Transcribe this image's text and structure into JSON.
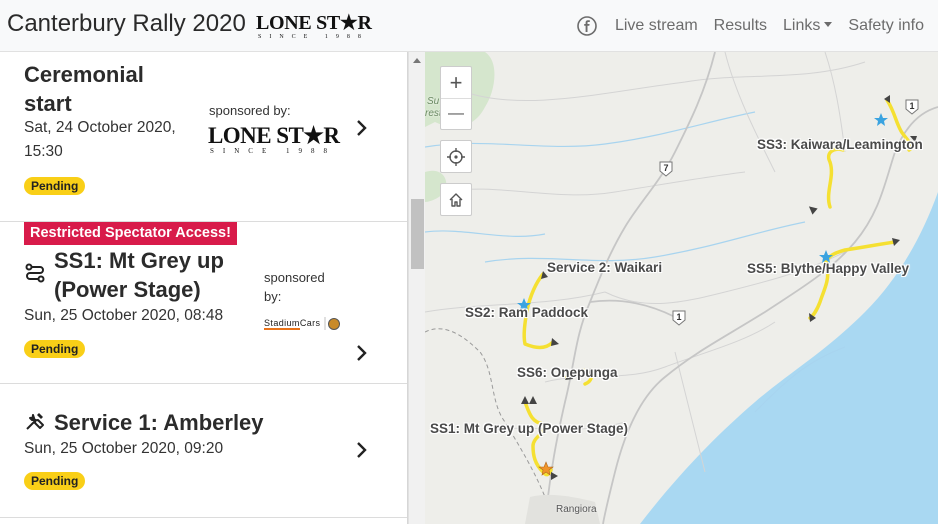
{
  "header": {
    "title": "Canterbury Rally 2020",
    "logo_text": "LONE STAR",
    "logo_subtext": "SINCE 1988",
    "nav": {
      "facebook_icon": "facebook-icon",
      "live_stream": "Live stream",
      "results": "Results",
      "links": "Links",
      "safety": "Safety info"
    }
  },
  "list": {
    "items": [
      {
        "title": "Ceremonial start",
        "title_line1": "Ceremonial",
        "title_line2": "start",
        "date_line1": "Sat, 24 October 2020,",
        "date_line2": "15:30",
        "sponsor_label": "sponsored by:",
        "sponsor_logo": "LONE STAR",
        "sponsor_sub": "SINCE 1988",
        "status": "Pending"
      },
      {
        "restricted": "Restricted Spectator Access!",
        "icon": "stage-route-icon",
        "title_line1": "SS1: Mt Grey up",
        "title_line2": "(Power Stage)",
        "date": "Sun, 25 October 2020, 08:48",
        "sponsor_label_1": "sponsored",
        "sponsor_label_2": "by:",
        "sponsor_logo": "StadiumCars",
        "status": "Pending"
      },
      {
        "icon": "service-wrench-icon",
        "title": "Service 1: Amberley",
        "date": "Sun, 25 October 2020, 09:20",
        "status": "Pending"
      }
    ]
  },
  "map": {
    "zoom_in": "+",
    "zoom_out": "—",
    "locate_icon": "crosshair-icon",
    "home_icon": "home-icon",
    "labels": {
      "ss3": "SS3: Kaiwara/Leamington",
      "service2": "Service 2: Waikari",
      "ss5": "SS5: Blythe/Happy Valley",
      "ss2": "SS2: Ram Paddock",
      "ss6": "SS6: Onepunga",
      "ss1": "SS1: Mt Grey up (Power Stage)",
      "town_rangiora": "Rangiora",
      "forest_1": "Su",
      "forest_2": "rest"
    },
    "roads": {
      "r1a": "1",
      "r1b": "1",
      "r7": "7"
    },
    "colors": {
      "route": "#f5e032",
      "sea": "#a9d8f2",
      "land": "#eeeeea",
      "forest": "#d5e6cd",
      "water": "#a8d4ef"
    }
  }
}
